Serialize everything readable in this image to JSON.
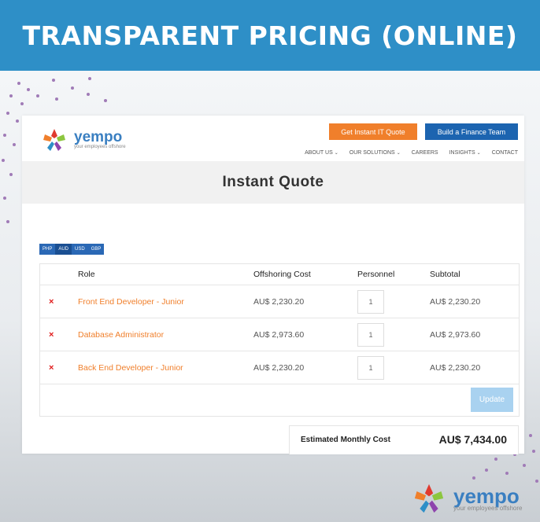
{
  "banner": {
    "title": "TRANSPARENT PRICING (ONLINE)"
  },
  "brand": {
    "name": "yempo",
    "tagline": "your employees offshore"
  },
  "header": {
    "quote_button": "Get Instant IT Quote",
    "finance_button": "Build a Finance Team",
    "nav": [
      {
        "label": "ABOUT US",
        "caret": "⌄"
      },
      {
        "label": "OUR SOLUTIONS",
        "caret": "⌄"
      },
      {
        "label": "CAREERS",
        "caret": ""
      },
      {
        "label": "INSIGHTS",
        "caret": "⌄"
      },
      {
        "label": "CONTACT",
        "caret": ""
      }
    ]
  },
  "page": {
    "title": "Instant Quote"
  },
  "currencies": [
    "PHP",
    "AUD",
    "USD",
    "GBP"
  ],
  "selected_currency": "AUD",
  "table": {
    "headers": {
      "role": "Role",
      "cost": "Offshoring Cost",
      "personnel": "Personnel",
      "subtotal": "Subtotal"
    },
    "remove_glyph": "×",
    "rows": [
      {
        "role": "Front End Developer - Junior",
        "cost": "AU$ 2,230.20",
        "personnel": "1",
        "subtotal": "AU$ 2,230.20"
      },
      {
        "role": "Database Administrator",
        "cost": "AU$ 2,973.60",
        "personnel": "1",
        "subtotal": "AU$ 2,973.60"
      },
      {
        "role": "Back End Developer - Junior",
        "cost": "AU$ 2,230.20",
        "personnel": "1",
        "subtotal": "AU$ 2,230.20"
      }
    ],
    "update_label": "Update"
  },
  "total": {
    "label": "Estimated Monthly Cost",
    "value": "AU$ 7,434.00"
  },
  "colors": {
    "banner": "#2e8fc7",
    "orange": "#f07f2b",
    "blue": "#1c64b0",
    "remove": "#e01b1b",
    "update": "#a9d2f0"
  }
}
